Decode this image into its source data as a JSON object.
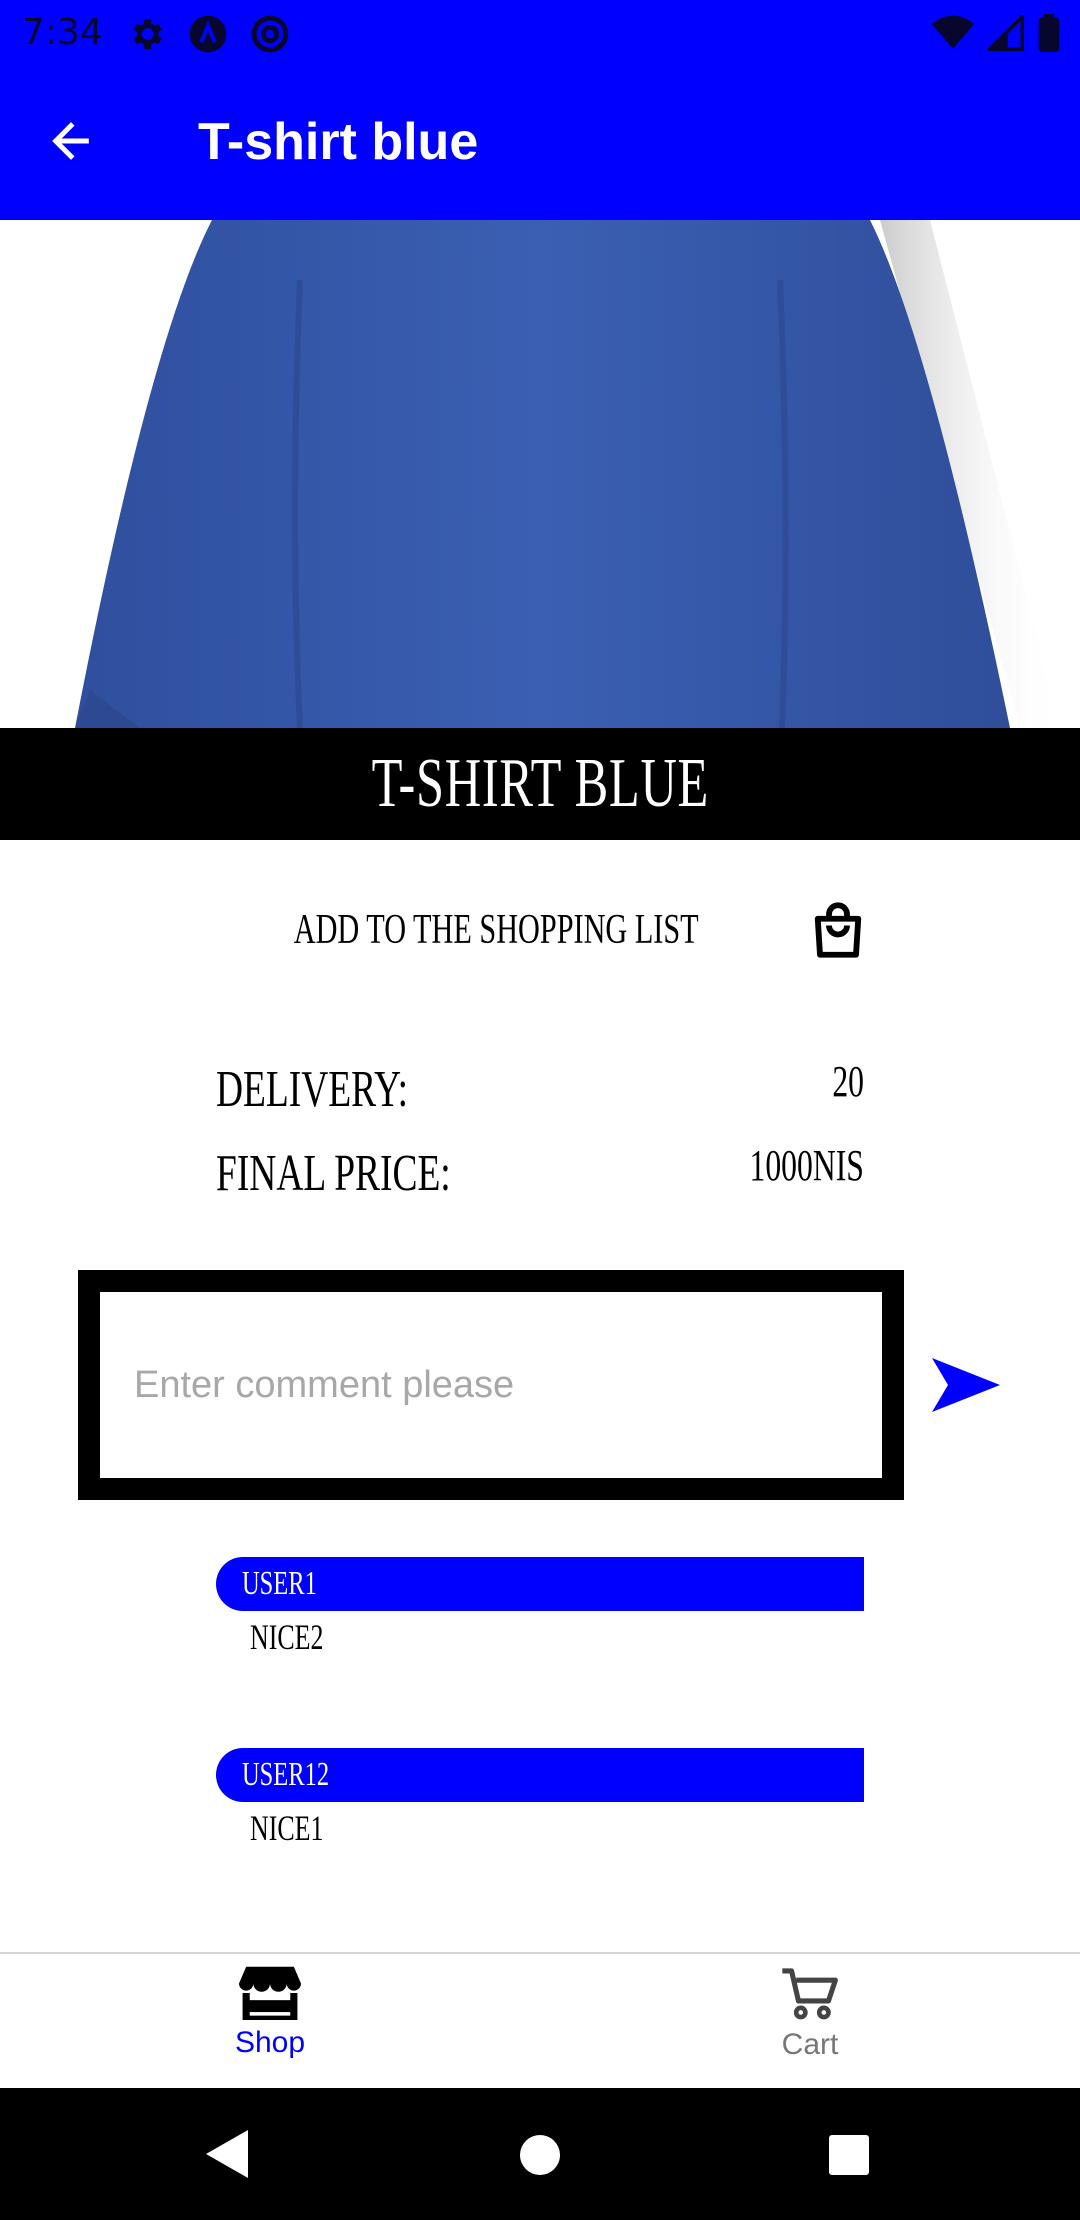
{
  "status_bar": {
    "time": "7:34"
  },
  "app_bar": {
    "title": "T-shirt blue"
  },
  "product": {
    "name_banner": "T-SHIRT BLUE",
    "add_to_list_label": "ADD TO THE SHOPPING LIST",
    "delivery_label": "DELIVERY:",
    "delivery_value": "20",
    "final_price_label": "FINAL PRICE:",
    "final_price_value": "1000NIS"
  },
  "comment_input": {
    "placeholder": "Enter comment please"
  },
  "comments": [
    {
      "user": "USER1",
      "text": "NICE2"
    },
    {
      "user": "USER12",
      "text": "NICE1"
    }
  ],
  "bottom_nav": {
    "shop_label": "Shop",
    "cart_label": "Cart"
  },
  "colors": {
    "accent": "#0000ff",
    "band": "#000000",
    "nav_inactive": "#777777"
  },
  "icons": [
    "settings-icon",
    "a-icon",
    "at-icon",
    "wifi-icon",
    "signal-icon",
    "battery-icon",
    "back-arrow-icon",
    "shopping-bag-icon",
    "send-icon",
    "store-icon",
    "cart-icon",
    "back-triangle-icon",
    "home-circle-icon",
    "recents-square-icon"
  ]
}
